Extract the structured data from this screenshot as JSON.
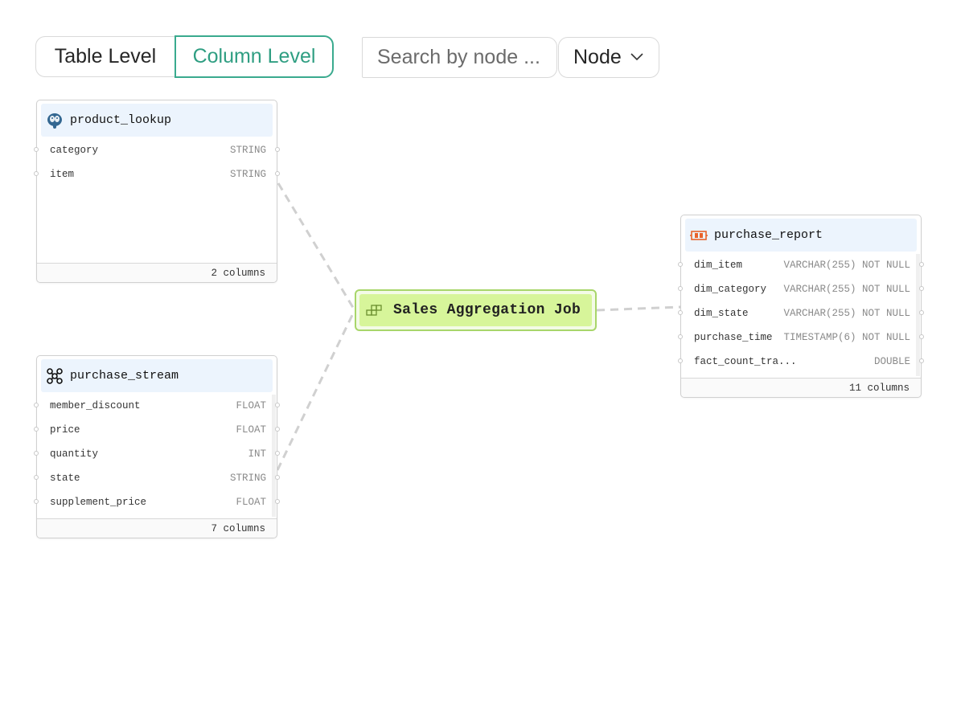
{
  "toolbar": {
    "level_tabs": [
      {
        "label": "Table Level",
        "active": false
      },
      {
        "label": "Column Level",
        "active": true
      }
    ],
    "search_placeholder": "Search by node ...",
    "node_select_value": "Node"
  },
  "colors": {
    "accent": "#3aaa8e",
    "job_fill": "#d7f59a",
    "job_border": "#a8d66a",
    "node_header": "#ecf4fd",
    "edge": "#d0d0d0"
  },
  "nodes": {
    "product_lookup": {
      "title": "product_lookup",
      "icon": "postgres-elephant-icon",
      "columns": [
        {
          "name": "category",
          "type": "STRING"
        },
        {
          "name": "item",
          "type": "STRING"
        }
      ],
      "footer": "2 columns"
    },
    "purchase_stream": {
      "title": "purchase_stream",
      "icon": "kafka-stream-icon",
      "columns": [
        {
          "name": "member_discount",
          "type": "FLOAT"
        },
        {
          "name": "price",
          "type": "FLOAT"
        },
        {
          "name": "quantity",
          "type": "INT"
        },
        {
          "name": "state",
          "type": "STRING"
        },
        {
          "name": "supplement_price",
          "type": "FLOAT"
        }
      ],
      "footer": "7 columns"
    },
    "purchase_report": {
      "title": "purchase_report",
      "icon": "report-table-icon",
      "columns": [
        {
          "name": "dim_item",
          "type": "VARCHAR(255) NOT NULL"
        },
        {
          "name": "dim_category",
          "type": "VARCHAR(255) NOT NULL"
        },
        {
          "name": "dim_state",
          "type": "VARCHAR(255) NOT NULL"
        },
        {
          "name": "purchase_time",
          "type": "TIMESTAMP(6) NOT NULL"
        },
        {
          "name": "fact_count_tra...",
          "type": "DOUBLE"
        }
      ],
      "footer": "11 columns"
    }
  },
  "job": {
    "title": "Sales Aggregation Job",
    "icon": "job-blocks-icon"
  }
}
